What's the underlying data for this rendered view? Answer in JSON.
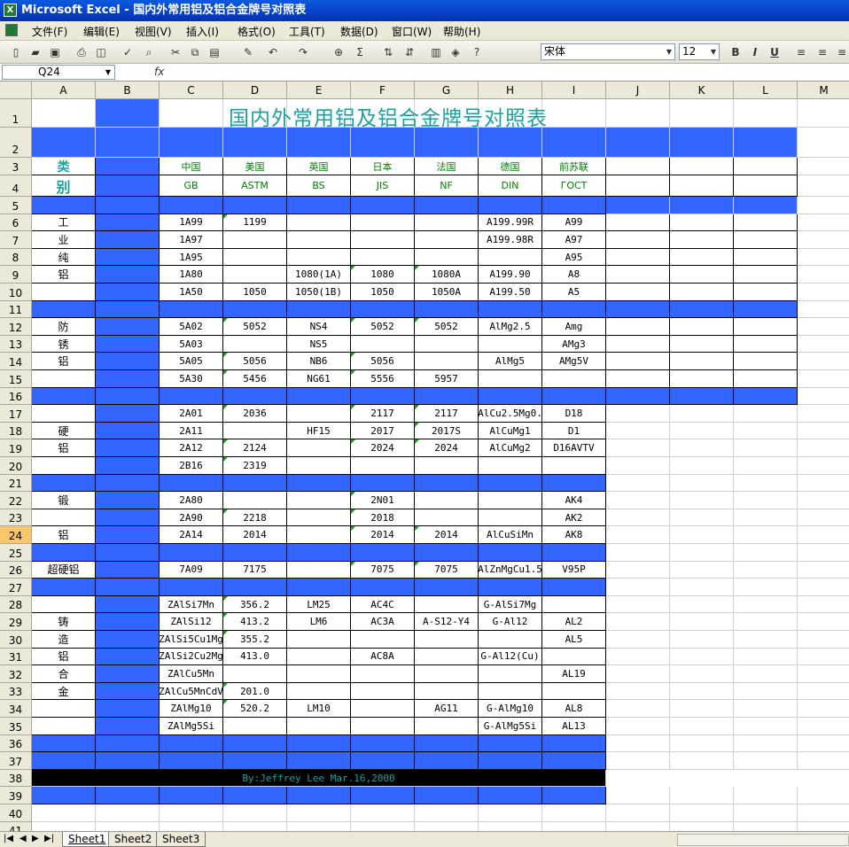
{
  "window": {
    "title": "Microsoft Excel - 国内外常用铝及铝合金牌号对照表"
  },
  "menu": [
    "文件(F)",
    "编辑(E)",
    "视图(V)",
    "插入(I)",
    "格式(O)",
    "工具(T)",
    "数据(D)",
    "窗口(W)",
    "帮助(H)"
  ],
  "toolbar": {
    "font_name": "宋体",
    "font_size": "12",
    "bold": "B",
    "italic": "I",
    "underline": "U"
  },
  "formula_bar": {
    "cell_ref": "Q24",
    "fx": "fx",
    "content": ""
  },
  "columns": [
    "A",
    "B",
    "C",
    "D",
    "E",
    "F",
    "G",
    "H",
    "I",
    "J",
    "K",
    "L",
    "M"
  ],
  "rows": [
    "1",
    "2",
    "3",
    "4",
    "5",
    "6",
    "7",
    "8",
    "9",
    "10",
    "11",
    "12",
    "13",
    "14",
    "15",
    "16",
    "17",
    "18",
    "19",
    "20",
    "21",
    "22",
    "23",
    "24",
    "25",
    "26",
    "27",
    "28",
    "29",
    "30",
    "31",
    "32",
    "33",
    "34",
    "35",
    "36",
    "37",
    "38",
    "39",
    "40",
    "41"
  ],
  "selected_row": "24",
  "sheet": {
    "title": "国内外常用铝及铝合金牌号对照表",
    "headers_country": [
      "类",
      "中国",
      "美国",
      "英国",
      "日本",
      "法国",
      "德国",
      "前苏联"
    ],
    "headers_standard": [
      "别",
      "GB",
      "ASTM",
      "BS",
      "JIS",
      "NF",
      "DIN",
      "ГОСТ"
    ],
    "data": [
      {
        "r": 6,
        "cat": "工",
        "v": [
          "1A99",
          "1199",
          "",
          "",
          "",
          "A199.99R",
          "A99"
        ]
      },
      {
        "r": 7,
        "cat": "业",
        "v": [
          "1A97",
          "",
          "",
          "",
          "",
          "A199.98R",
          "A97"
        ]
      },
      {
        "r": 8,
        "cat": "纯",
        "v": [
          "1A95",
          "",
          "",
          "",
          "",
          "",
          "A95"
        ]
      },
      {
        "r": 9,
        "cat": "铝",
        "v": [
          "1A80",
          "",
          "1080(1A)",
          "1080",
          "1080A",
          "A199.90",
          "A8"
        ]
      },
      {
        "r": 10,
        "cat": "",
        "v": [
          "1A50",
          "1050",
          "1050(1B)",
          "1050",
          "1050A",
          "A199.50",
          "A5"
        ]
      },
      {
        "r": 12,
        "cat": "防",
        "v": [
          "5A02",
          "5052",
          "NS4",
          "5052",
          "5052",
          "AlMg2.5",
          "Amg"
        ]
      },
      {
        "r": 13,
        "cat": "锈",
        "v": [
          "5A03",
          "",
          "NS5",
          "",
          "",
          "",
          "AMg3"
        ]
      },
      {
        "r": 14,
        "cat": "铝",
        "v": [
          "5A05",
          "5056",
          "NB6",
          "5056",
          "",
          "AlMg5",
          "AMg5V"
        ]
      },
      {
        "r": 15,
        "cat": "",
        "v": [
          "5A30",
          "5456",
          "NG61",
          "5556",
          "5957",
          "",
          ""
        ]
      },
      {
        "r": 17,
        "cat": "",
        "v": [
          "2A01",
          "2036",
          "",
          "2117",
          "2117",
          "AlCu2.5Mg0.",
          "D18"
        ]
      },
      {
        "r": 18,
        "cat": "硬",
        "v": [
          "2A11",
          "",
          "HF15",
          "2017",
          "2017S",
          "AlCuMg1",
          "D1"
        ]
      },
      {
        "r": 19,
        "cat": "铝",
        "v": [
          "2A12",
          "2124",
          "",
          "2024",
          "2024",
          "AlCuMg2",
          "D16AVTV"
        ]
      },
      {
        "r": 20,
        "cat": "",
        "v": [
          "2B16",
          "2319",
          "",
          "",
          "",
          "",
          ""
        ]
      },
      {
        "r": 22,
        "cat": "锻",
        "v": [
          "2A80",
          "",
          "",
          "2N01",
          "",
          "",
          "AK4"
        ]
      },
      {
        "r": 23,
        "cat": "",
        "v": [
          "2A90",
          "2218",
          "",
          "2018",
          "",
          "",
          "AK2"
        ]
      },
      {
        "r": 24,
        "cat": "铝",
        "v": [
          "2A14",
          "2014",
          "",
          "2014",
          "2014",
          "AlCuSiMn",
          "AK8"
        ]
      },
      {
        "r": 26,
        "cat": "超硬铝",
        "v": [
          "7A09",
          "7175",
          "",
          "7075",
          "7075",
          "AlZnMgCu1.5",
          "V95P"
        ]
      },
      {
        "r": 28,
        "cat": "",
        "v": [
          "ZAlSi7Mn",
          "356.2",
          "LM25",
          "AC4C",
          "",
          "G-AlSi7Mg",
          ""
        ]
      },
      {
        "r": 29,
        "cat": "铸",
        "v": [
          "ZAlSi12",
          "413.2",
          "LM6",
          "AC3A",
          "A-S12-Y4",
          "G-Al12",
          "AL2"
        ]
      },
      {
        "r": 30,
        "cat": "造",
        "v": [
          "ZAlSi5Cu1Mg",
          "355.2",
          "",
          "",
          "",
          "",
          "AL5"
        ]
      },
      {
        "r": 31,
        "cat": "铝",
        "v": [
          "ZAlSi2Cu2Mg",
          "413.0",
          "",
          "AC8A",
          "",
          "G-Al12(Cu)",
          ""
        ]
      },
      {
        "r": 32,
        "cat": "合",
        "v": [
          "ZAlCu5Mn",
          "",
          "",
          "",
          "",
          "",
          "AL19"
        ]
      },
      {
        "r": 33,
        "cat": "金",
        "v": [
          "ZAlCu5MnCdV",
          "201.0",
          "",
          "",
          "",
          "",
          ""
        ]
      },
      {
        "r": 34,
        "cat": "",
        "v": [
          "ZAlMg10",
          "520.2",
          "LM10",
          "",
          "AG11",
          "G-AlMg10",
          "AL8"
        ]
      },
      {
        "r": 35,
        "cat": "",
        "v": [
          "ZAlMg5Si",
          "",
          "",
          "",
          "",
          "G-AlMg5Si",
          "AL13"
        ]
      }
    ],
    "footer": "By:Jeffrey Lee Mar.16,2000"
  },
  "tabs": [
    "Sheet1",
    "Sheet2",
    "Sheet3"
  ],
  "active_tab": "Sheet1",
  "colors": {
    "blue_fill": "#3366ff",
    "title_teal": "#1fa0a0",
    "header_green": "#008000"
  }
}
